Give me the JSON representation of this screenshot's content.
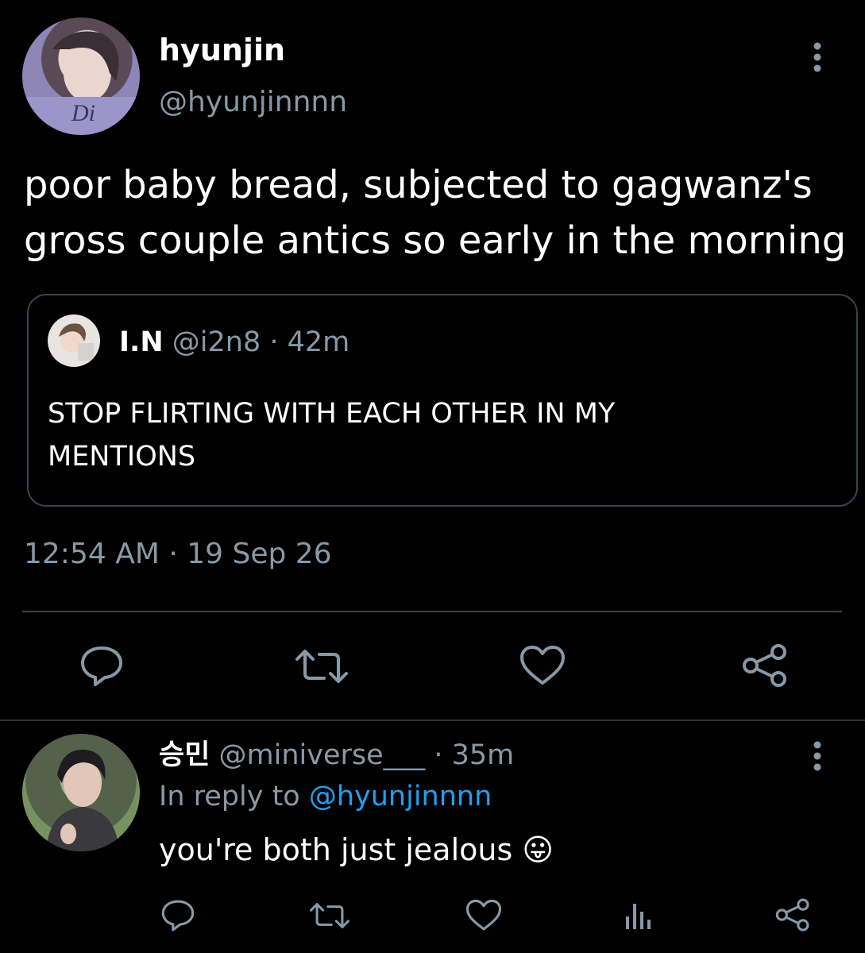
{
  "tweet": {
    "display_name": "hyunjin",
    "handle": "@hyunjinnnn",
    "text_line1": "poor baby bread, subjected to gagwanz's",
    "text_line2": "gross couple antics so early in the morning",
    "timestamp": "12:54 AM",
    "date": "19 Sep 26",
    "separator": "·"
  },
  "quoted": {
    "display_name": "I.N",
    "handle": "@i2n8",
    "time": "42m",
    "separator": "·",
    "text_line1": "STOP FLIRTING WITH EACH OTHER IN MY",
    "text_line2": "MENTIONS"
  },
  "reply": {
    "display_name": "승민",
    "handle": "@miniverse___",
    "time": "35m",
    "separator": "·",
    "in_reply_prefix": "In reply to",
    "in_reply_handle": "@hyunjinnnn",
    "text": "you're both just jealous",
    "emoji": "😛"
  },
  "icons": {
    "reply": "reply-icon",
    "retweet": "retweet-icon",
    "like": "heart-icon",
    "share": "share-icon",
    "analytics": "analytics-icon",
    "more": "more-vertical-icon"
  },
  "colors": {
    "background": "#000000",
    "text": "#ffffff",
    "muted": "#8899a6",
    "link": "#1da1f2",
    "border": "#38444d"
  }
}
